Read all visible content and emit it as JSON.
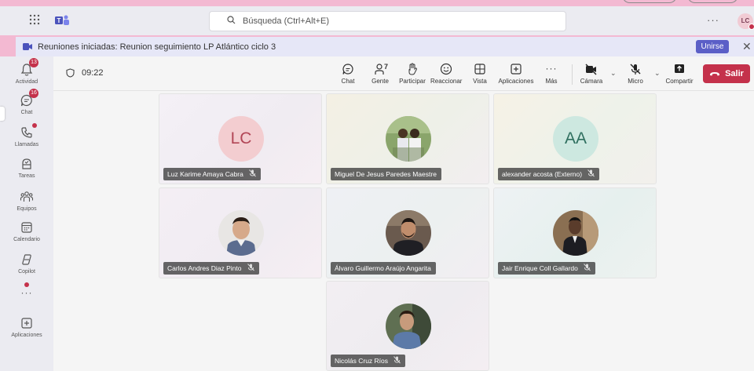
{
  "search": {
    "placeholder": "Búsqueda (Ctrl+Alt+E)"
  },
  "user": {
    "initials": "LC"
  },
  "banner": {
    "text": "Reuniones iniciadas: Reunion seguimiento LP Atlántico ciclo 3",
    "join_label": "Unirse"
  },
  "rail": {
    "activity": {
      "label": "Actividad",
      "badge": "13"
    },
    "chat": {
      "label": "Chat",
      "badge": "16"
    },
    "calls": {
      "label": "Llamadas"
    },
    "tasks": {
      "label": "Tareas"
    },
    "teams": {
      "label": "Equipos"
    },
    "calendar": {
      "label": "Calendario"
    },
    "copilot": {
      "label": "Copilot"
    },
    "apps": {
      "label": "Aplicaciones"
    }
  },
  "meeting": {
    "timer": "09:22",
    "controls": {
      "chat": "Chat",
      "people": "Gente",
      "people_count": "7",
      "raise": "Participar",
      "react": "Reaccionar",
      "view": "Vista",
      "apps": "Aplicaciones",
      "more": "Más",
      "camera": "Cámara",
      "mic": "Micro",
      "share": "Compartir",
      "leave": "Salir"
    }
  },
  "participants": [
    {
      "name": "Luz Karime Amaya Cabra",
      "initials": "LC",
      "muted": true,
      "avatar": "initials",
      "color": "#f3cdd0",
      "text_color": "#b24656"
    },
    {
      "name": "Miguel De Jesus Paredes Maestre",
      "initials": "",
      "muted": false,
      "avatar": "photo"
    },
    {
      "name": "alexander acosta (Externo)",
      "initials": "AA",
      "muted": true,
      "avatar": "initials",
      "color": "#cde8e0",
      "text_color": "#2f6f5f"
    },
    {
      "name": "Carlos Andres Diaz Pinto",
      "initials": "",
      "muted": true,
      "avatar": "photo"
    },
    {
      "name": "Álvaro Guillermo Araújo Angarita",
      "initials": "",
      "muted": false,
      "avatar": "photo"
    },
    {
      "name": "Jair Enrique Coll Gallardo",
      "initials": "",
      "muted": true,
      "avatar": "photo"
    },
    {
      "name": "Nicolás Cruz Ríos",
      "initials": "",
      "muted": true,
      "avatar": "photo"
    }
  ]
}
